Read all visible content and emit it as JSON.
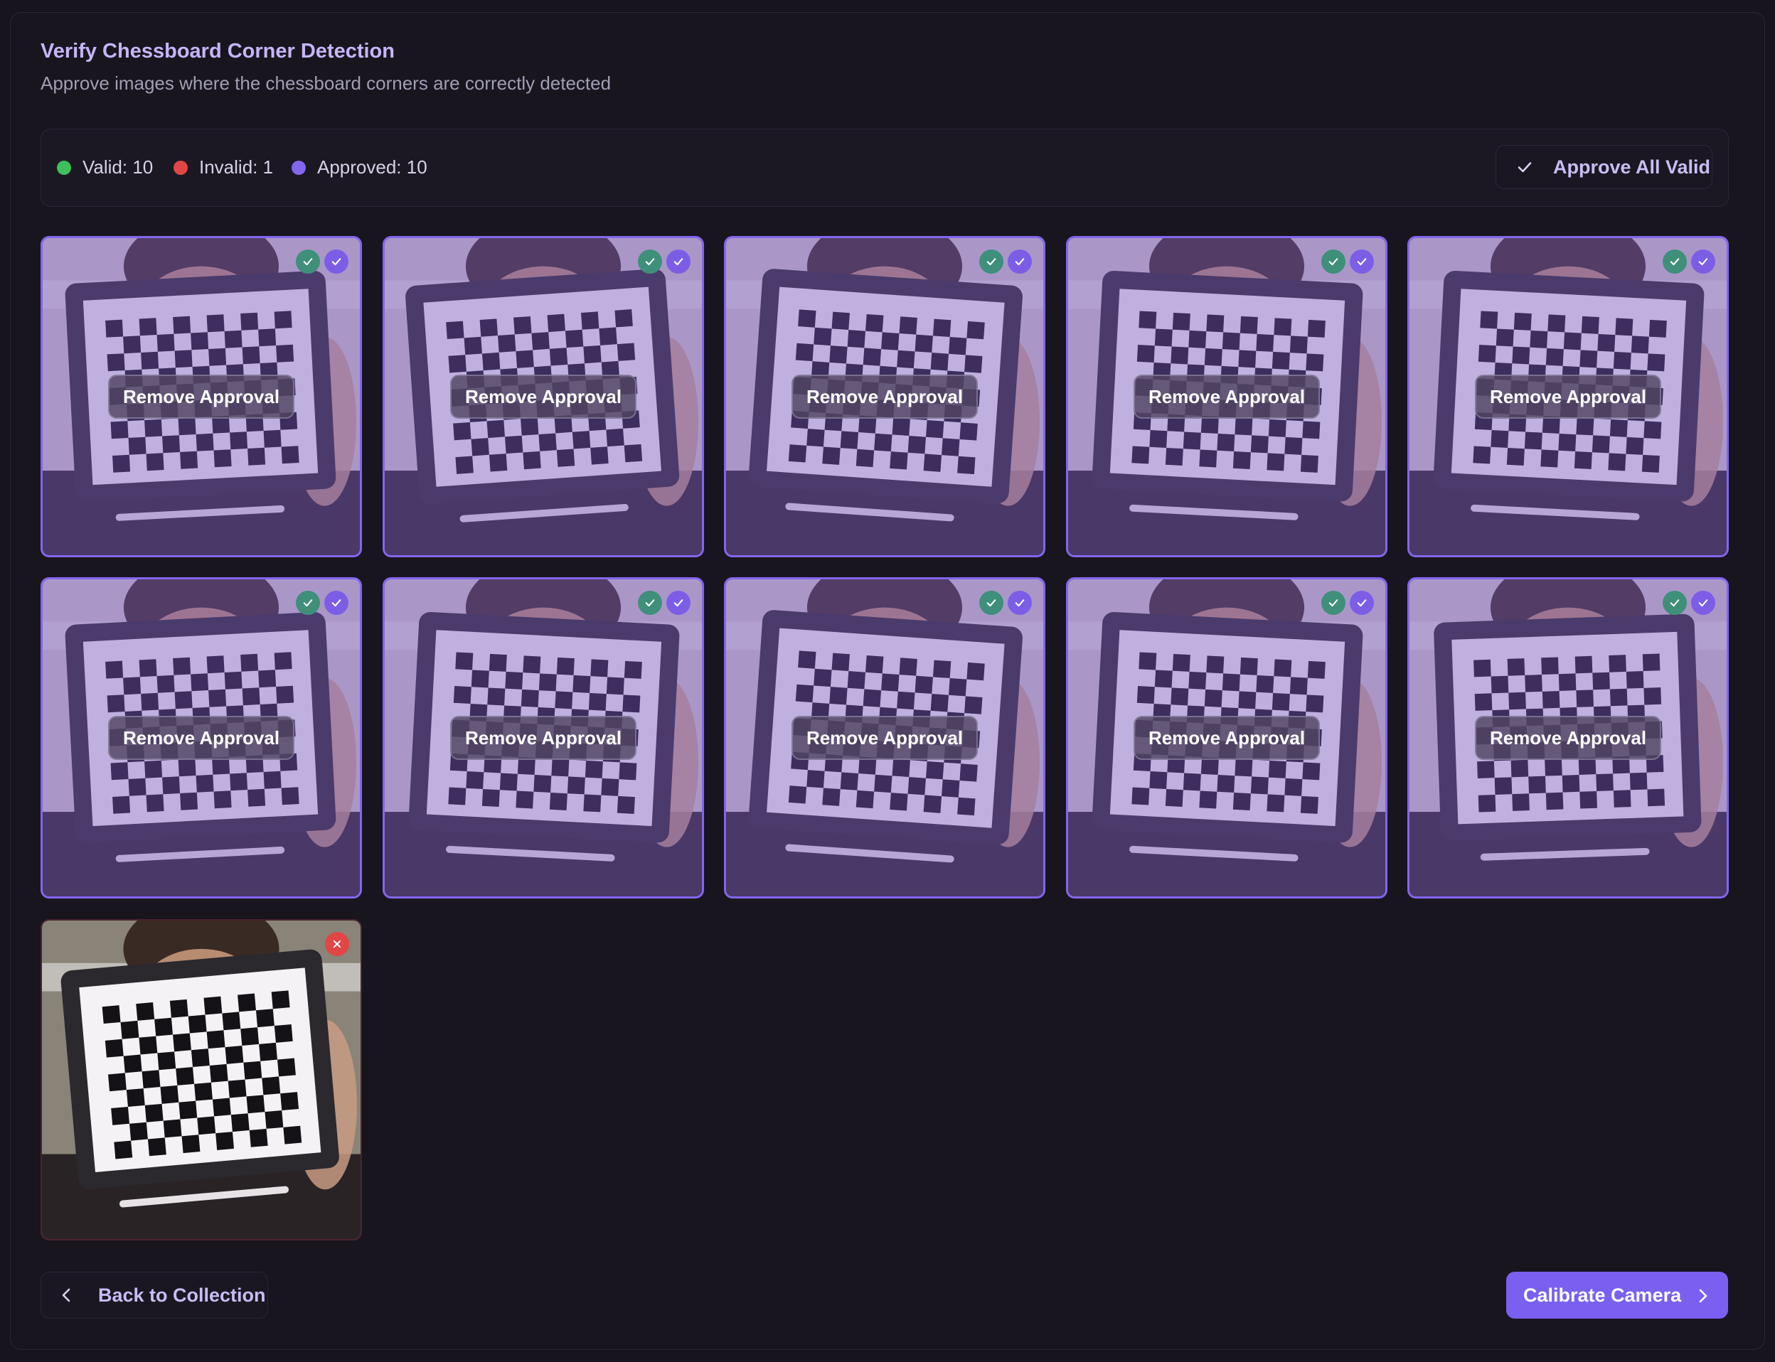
{
  "header": {
    "title": "Verify Chessboard Corner Detection",
    "subtitle": "Approve images where the chessboard corners are correctly detected"
  },
  "stats": {
    "valid_label": "Valid: 10",
    "invalid_label": "Invalid: 1",
    "approved_label": "Approved: 10",
    "approve_all_label": "Approve All Valid"
  },
  "colors": {
    "accent": "#7b5ff1",
    "valid": "#3fbf5a",
    "invalid": "#e14646",
    "approved": "#8366ee"
  },
  "images": [
    {
      "status": "approved",
      "action_label": "Remove Approval"
    },
    {
      "status": "approved",
      "action_label": "Remove Approval"
    },
    {
      "status": "approved",
      "action_label": "Remove Approval"
    },
    {
      "status": "approved",
      "action_label": "Remove Approval"
    },
    {
      "status": "approved",
      "action_label": "Remove Approval"
    },
    {
      "status": "approved",
      "action_label": "Remove Approval"
    },
    {
      "status": "approved",
      "action_label": "Remove Approval"
    },
    {
      "status": "approved",
      "action_label": "Remove Approval"
    },
    {
      "status": "approved",
      "action_label": "Remove Approval"
    },
    {
      "status": "approved",
      "action_label": "Remove Approval"
    },
    {
      "status": "invalid"
    }
  ],
  "footer": {
    "back_label": "Back to Collection",
    "calibrate_label": "Calibrate Camera"
  }
}
